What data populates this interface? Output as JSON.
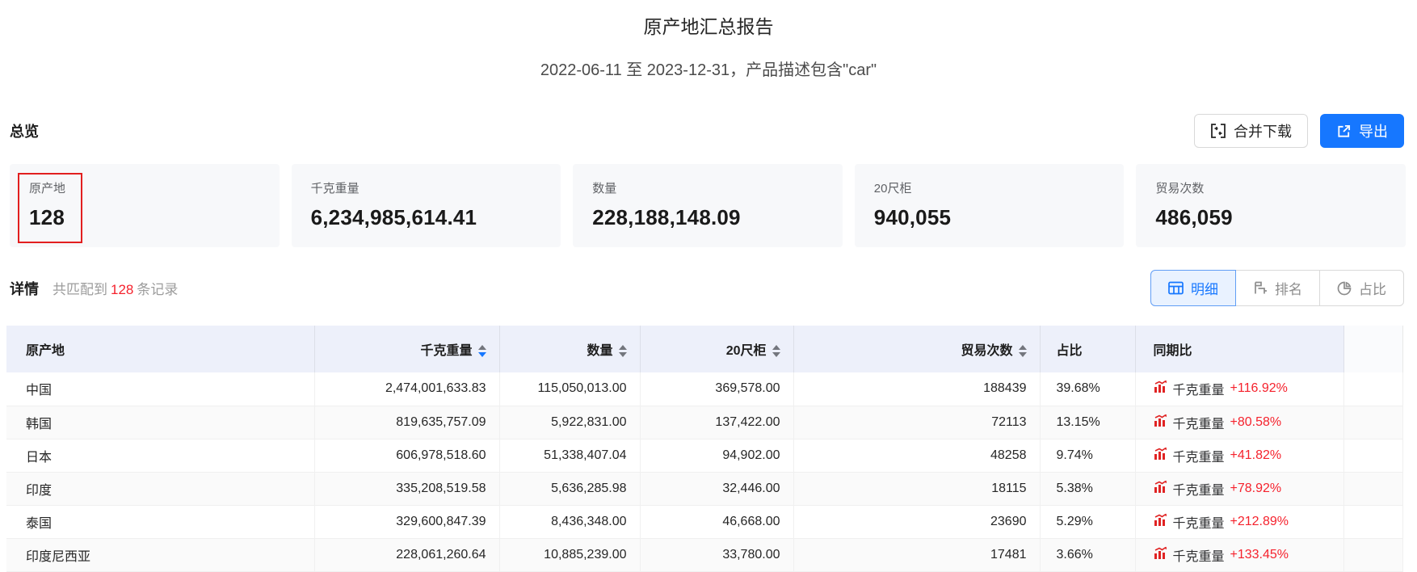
{
  "header": {
    "title": "原产地汇总报告",
    "subtitle": "2022-06-11 至 2023-12-31，产品描述包含\"car\""
  },
  "colors": {
    "primary_blue": "#1677ff",
    "alert_red": "#f5222d",
    "annotation_red": "#e21f1f",
    "card_bg": "#f7f8fa",
    "table_header_bg": "#edf0fa"
  },
  "overview": {
    "heading": "总览",
    "merge_download_label": "合并下载",
    "export_label": "导出",
    "cards": [
      {
        "label": "原产地",
        "value": "128",
        "highlighted": true
      },
      {
        "label": "千克重量",
        "value": "6,234,985,614.41",
        "highlighted": false
      },
      {
        "label": "数量",
        "value": "228,188,148.09",
        "highlighted": false
      },
      {
        "label": "20尺柜",
        "value": "940,055",
        "highlighted": false
      },
      {
        "label": "贸易次数",
        "value": "486,059",
        "highlighted": false
      }
    ]
  },
  "detail": {
    "heading": "详情",
    "match_prefix": "共匹配到",
    "match_count": "128",
    "match_suffix": "条记录",
    "tabs": [
      {
        "key": "detail",
        "label": "明细",
        "icon": "table-icon",
        "active": true
      },
      {
        "key": "ranking",
        "label": "排名",
        "icon": "ranking-icon",
        "active": false
      },
      {
        "key": "share",
        "label": "占比",
        "icon": "pie-icon",
        "active": false
      }
    ]
  },
  "table": {
    "columns": [
      {
        "key": "origin",
        "label": "原产地",
        "align": "left",
        "sortable": false
      },
      {
        "key": "weight",
        "label": "千克重量",
        "align": "right",
        "sortable": true,
        "sorted": "desc"
      },
      {
        "key": "quantity",
        "label": "数量",
        "align": "right",
        "sortable": true,
        "sorted": null
      },
      {
        "key": "teu",
        "label": "20尺柜",
        "align": "right",
        "sortable": true,
        "sorted": null
      },
      {
        "key": "trades",
        "label": "贸易次数",
        "align": "right",
        "sortable": true,
        "sorted": null
      },
      {
        "key": "share",
        "label": "占比",
        "align": "left",
        "sortable": false
      },
      {
        "key": "yoy",
        "label": "同期比",
        "align": "left",
        "sortable": false
      }
    ],
    "yoy_metric_label": "千克重量",
    "rows": [
      {
        "origin": "中国",
        "weight": "2,474,001,633.83",
        "quantity": "115,050,013.00",
        "teu": "369,578.00",
        "trades": "188439",
        "share": "39.68%",
        "yoy": "+116.92%"
      },
      {
        "origin": "韩国",
        "weight": "819,635,757.09",
        "quantity": "5,922,831.00",
        "teu": "137,422.00",
        "trades": "72113",
        "share": "13.15%",
        "yoy": "+80.58%"
      },
      {
        "origin": "日本",
        "weight": "606,978,518.60",
        "quantity": "51,338,407.04",
        "teu": "94,902.00",
        "trades": "48258",
        "share": "9.74%",
        "yoy": "+41.82%"
      },
      {
        "origin": "印度",
        "weight": "335,208,519.58",
        "quantity": "5,636,285.98",
        "teu": "32,446.00",
        "trades": "18115",
        "share": "5.38%",
        "yoy": "+78.92%"
      },
      {
        "origin": "泰国",
        "weight": "329,600,847.39",
        "quantity": "8,436,348.00",
        "teu": "46,668.00",
        "trades": "23690",
        "share": "5.29%",
        "yoy": "+212.89%"
      },
      {
        "origin": "印度尼西亚",
        "weight": "228,061,260.64",
        "quantity": "10,885,239.00",
        "teu": "33,780.00",
        "trades": "17481",
        "share": "3.66%",
        "yoy": "+133.45%"
      }
    ]
  }
}
